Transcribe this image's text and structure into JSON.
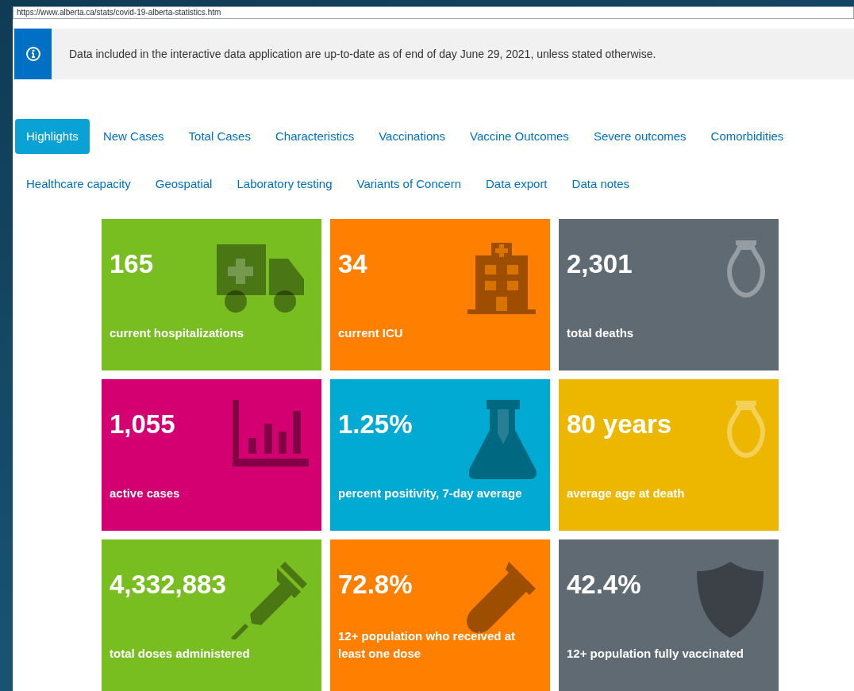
{
  "url": "https://www.alberta.ca/stats/covid-19-alberta-statistics.htm",
  "notice": "Data included in the interactive data application are up-to-date as of end of day June 29, 2021, unless stated otherwise.",
  "tabs": [
    {
      "label": "Highlights",
      "selected": true
    },
    {
      "label": "New Cases",
      "selected": false
    },
    {
      "label": "Total Cases",
      "selected": false
    },
    {
      "label": "Characteristics",
      "selected": false
    },
    {
      "label": "Vaccinations",
      "selected": false
    },
    {
      "label": "Vaccine Outcomes",
      "selected": false
    },
    {
      "label": "Severe outcomes",
      "selected": false
    },
    {
      "label": "Comorbidities",
      "selected": false
    },
    {
      "label": "Healthcare capacity",
      "selected": false
    },
    {
      "label": "Geospatial",
      "selected": false
    },
    {
      "label": "Laboratory testing",
      "selected": false
    },
    {
      "label": "Variants of Concern",
      "selected": false
    },
    {
      "label": "Data export",
      "selected": false
    },
    {
      "label": "Data notes",
      "selected": false
    }
  ],
  "tiles": [
    {
      "value": "165",
      "label": "current hospitalizations",
      "color": "#78be21"
    },
    {
      "value": "34",
      "label": "current ICU",
      "color": "#ff7f00"
    },
    {
      "value": "2,301",
      "label": "total deaths",
      "color": "#5f6a72"
    },
    {
      "value": "1,055",
      "label": "active cases",
      "color": "#d40072"
    },
    {
      "value": "1.25%",
      "label": "percent positivity, 7-day average",
      "color": "#00aad2"
    },
    {
      "value": "80 years",
      "label": "average age at death",
      "color": "#edb700"
    },
    {
      "value": "4,332,883",
      "label": "total doses administered",
      "color": "#78be21"
    },
    {
      "value": "72.8%",
      "label": "12+ population who received at least one dose",
      "color": "#ff7f00"
    },
    {
      "value": "42.4%",
      "label": "12+ population fully vaccinated",
      "color": "#5f6a72"
    }
  ]
}
